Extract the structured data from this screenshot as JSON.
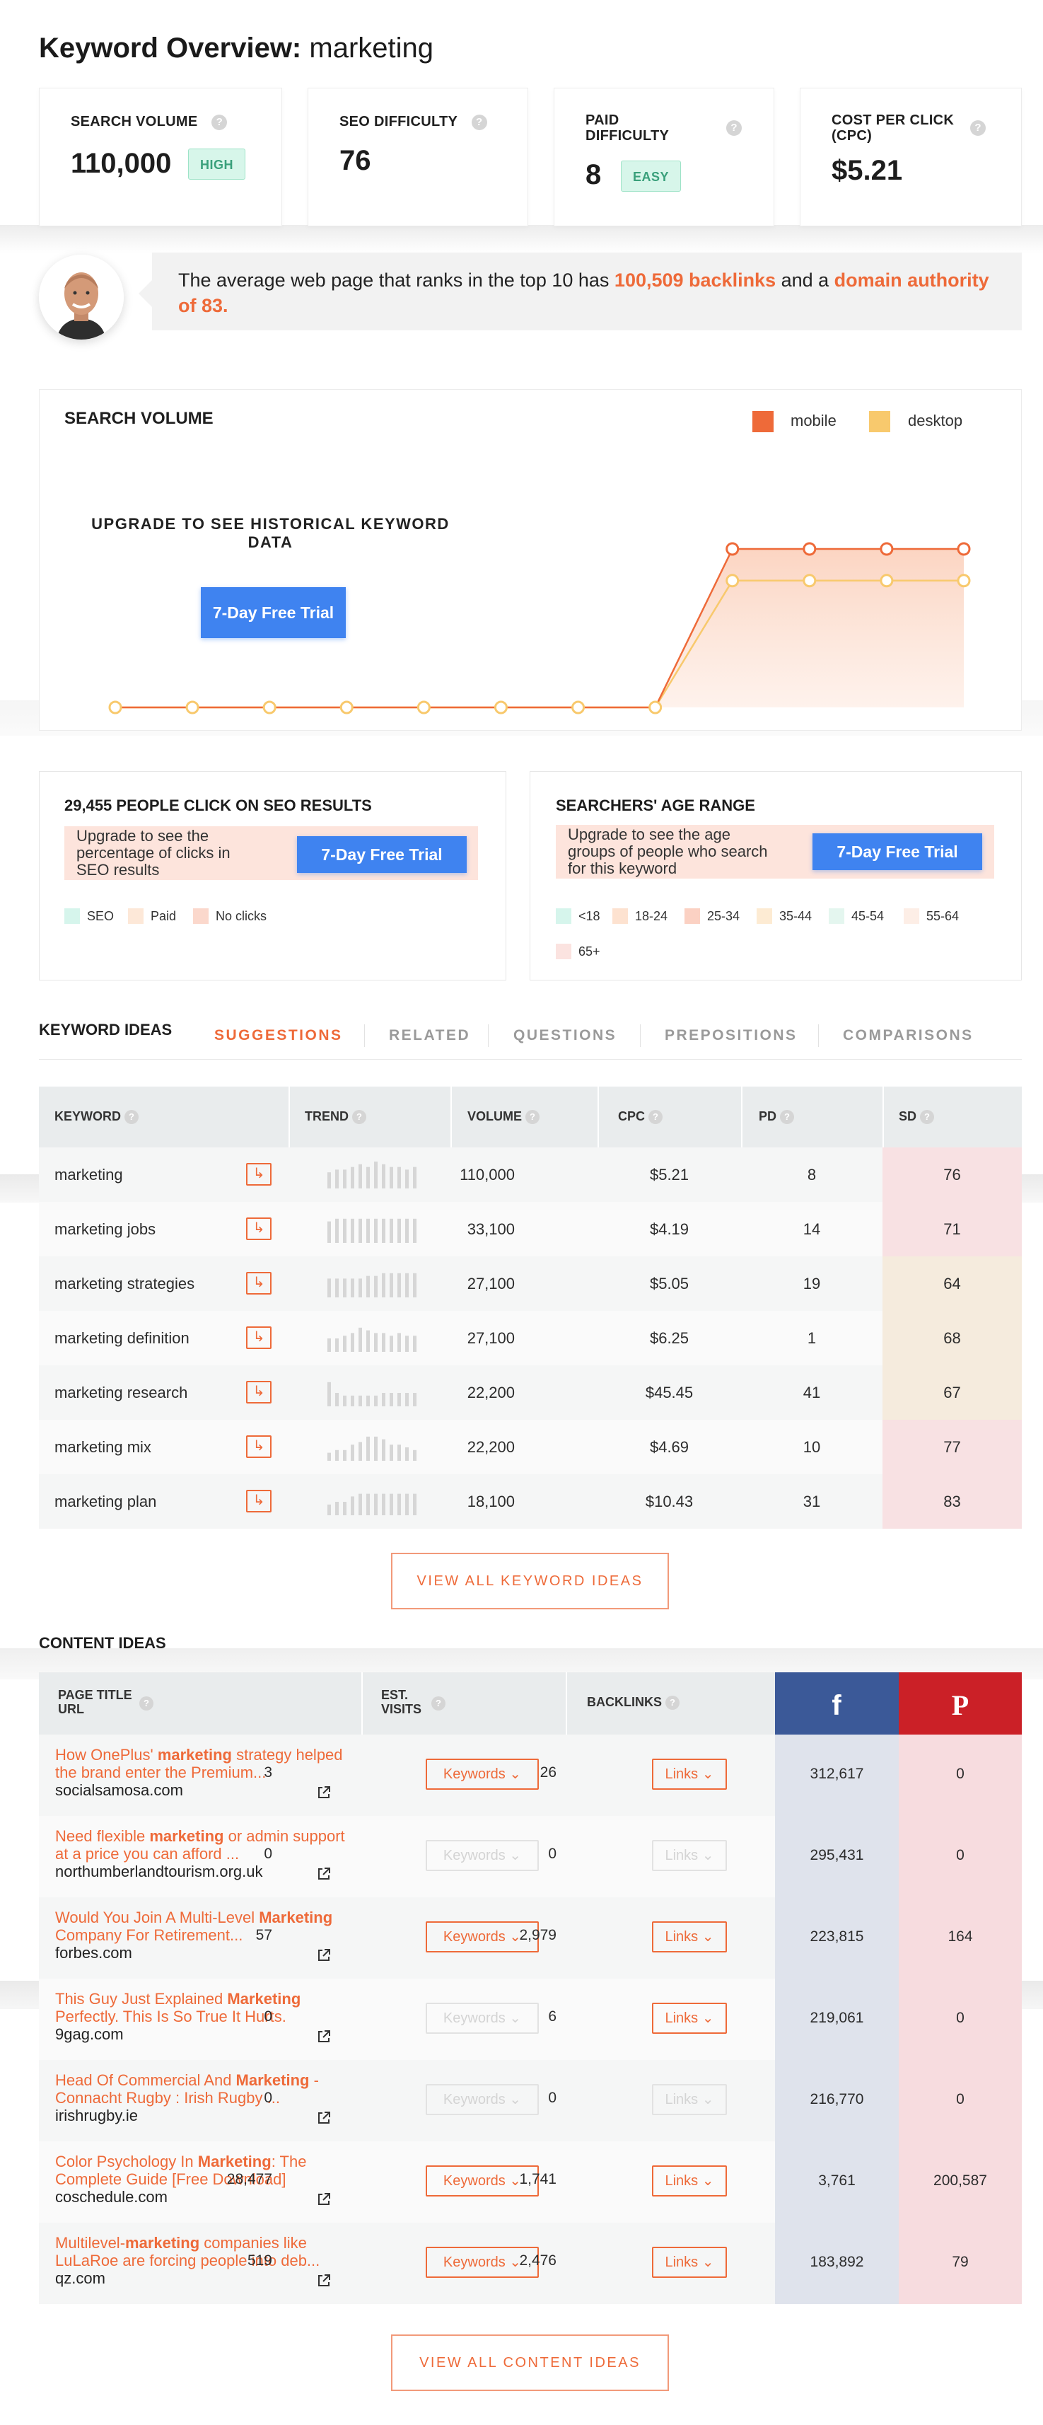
{
  "header": {
    "title_bold": "Keyword Overview:",
    "keyword": "marketing"
  },
  "metrics": [
    {
      "label": "SEARCH VOLUME",
      "value": "110,000",
      "badge": "HIGH",
      "help": "?"
    },
    {
      "label": "SEO DIFFICULTY",
      "value": "76",
      "help": "?"
    },
    {
      "label_line1": "PAID",
      "label_line2": "DIFFICULTY",
      "value": "8",
      "badge": "EASY",
      "help": "?"
    },
    {
      "label_line1": "COST PER CLICK",
      "label_line2": "(CPC)",
      "value": "$5.21",
      "help": "?"
    }
  ],
  "banner": {
    "prefix": "The average web page that ranks in the top 10 has ",
    "backlinks": "100,509 backlinks",
    "middle": " and a ",
    "authority": "domain authority of 83",
    "suffix": "."
  },
  "search_volume": {
    "title": "SEARCH VOLUME",
    "legend": [
      {
        "label": "mobile",
        "color": "#ee6a39"
      },
      {
        "label": "desktop",
        "color": "#f8c96d"
      }
    ],
    "upgrade_text": "UPGRADE TO SEE HISTORICAL KEYWORD DATA",
    "trial_label": "7-Day Free Trial",
    "chart": {
      "points": 12,
      "mobile": [
        0,
        0,
        0,
        0,
        0,
        0,
        0,
        0,
        1,
        1,
        1,
        1
      ],
      "desktop": [
        0,
        0,
        0,
        0,
        0,
        0,
        0,
        0,
        0.8,
        0.8,
        0.8,
        0.8
      ]
    }
  },
  "clicks_panel": {
    "title": "29,455 PEOPLE CLICK ON SEO RESULTS",
    "upsell": "Upgrade to see the percentage of clicks in SEO results",
    "trial_label": "7-Day Free Trial",
    "legend": [
      {
        "label": "SEO",
        "color": "#d6f5ec"
      },
      {
        "label": "Paid",
        "color": "#fde8d8"
      },
      {
        "label": "No clicks",
        "color": "#fbd8cc"
      }
    ]
  },
  "age_panel": {
    "title": "SEARCHERS' AGE RANGE",
    "upsell": "Upgrade to see the age groups of people who search for this keyword",
    "trial_label": "7-Day Free Trial",
    "legend": [
      {
        "label": "<18",
        "color": "#d6f5ec"
      },
      {
        "label": "18-24",
        "color": "#fde2d0"
      },
      {
        "label": "25-34",
        "color": "#fbd1c3"
      },
      {
        "label": "35-44",
        "color": "#fdebd3"
      },
      {
        "label": "45-54",
        "color": "#e4f6ef"
      },
      {
        "label": "55-64",
        "color": "#fdeee6"
      },
      {
        "label": "65+",
        "color": "#fbe3e0"
      }
    ]
  },
  "keyword_ideas": {
    "title": "KEYWORD IDEAS",
    "tabs": [
      "SUGGESTIONS",
      "RELATED",
      "QUESTIONS",
      "PREPOSITIONS",
      "COMPARISONS"
    ],
    "active_tab": 0,
    "columns": [
      "KEYWORD",
      "TREND",
      "VOLUME",
      "CPC",
      "PD",
      "SD"
    ],
    "rows": [
      {
        "keyword": "marketing",
        "volume": "110,000",
        "cpc": "$5.21",
        "pd": "8",
        "sd": "76",
        "sd_color": "#f8e1e3",
        "trend": [
          6,
          7,
          7,
          8,
          9,
          8,
          10,
          9,
          8,
          8,
          7,
          8
        ]
      },
      {
        "keyword": "marketing jobs",
        "volume": "33,100",
        "cpc": "$4.19",
        "pd": "14",
        "sd": "71",
        "sd_color": "#f8e1e3",
        "trend": [
          8,
          9,
          9,
          9,
          9,
          9,
          9,
          9,
          9,
          9,
          9,
          9
        ]
      },
      {
        "keyword": "marketing strategies",
        "volume": "27,100",
        "cpc": "$5.05",
        "pd": "19",
        "sd": "64",
        "sd_color": "#f5ebdd",
        "trend": [
          7,
          7,
          7,
          7,
          7,
          8,
          8,
          9,
          9,
          9,
          9,
          9
        ]
      },
      {
        "keyword": "marketing definition",
        "volume": "27,100",
        "cpc": "$6.25",
        "pd": "1",
        "sd": "68",
        "sd_color": "#f5ebdd",
        "trend": [
          5,
          5,
          6,
          7,
          9,
          8,
          7,
          7,
          6,
          7,
          6,
          6
        ]
      },
      {
        "keyword": "marketing research",
        "volume": "22,200",
        "cpc": "$45.45",
        "pd": "41",
        "sd": "67",
        "sd_color": "#f5ebdd",
        "trend": [
          9,
          5,
          4,
          4,
          4,
          4,
          4,
          5,
          5,
          5,
          5,
          5
        ]
      },
      {
        "keyword": "marketing mix",
        "volume": "22,200",
        "cpc": "$4.69",
        "pd": "10",
        "sd": "77",
        "sd_color": "#f8e1e3",
        "trend": [
          3,
          4,
          4,
          6,
          7,
          9,
          9,
          8,
          6,
          6,
          5,
          4
        ]
      },
      {
        "keyword": "marketing plan",
        "volume": "18,100",
        "cpc": "$10.43",
        "pd": "31",
        "sd": "83",
        "sd_color": "#f8e1e3",
        "trend": [
          4,
          5,
          5,
          7,
          8,
          8,
          8,
          8,
          8,
          8,
          8,
          8
        ]
      }
    ],
    "view_all": "VIEW ALL KEYWORD IDEAS"
  },
  "content_ideas": {
    "title": "CONTENT IDEAS",
    "columns": {
      "page_title": "PAGE TITLE",
      "url": "URL",
      "visits_1": "EST.",
      "visits_2": "VISITS",
      "backlinks": "BACKLINKS",
      "facebook": "f",
      "pinterest": "P"
    },
    "keywords_label": "Keywords",
    "links_label": "Links",
    "rows": [
      {
        "title_pre": "How OnePlus' ",
        "title_bold": "marketing",
        "title_post": " strategy helped the brand enter the Premium...",
        "domain": "socialsamosa.com",
        "visits": "3",
        "visits_active": true,
        "backlinks": "26",
        "links_active": true,
        "facebook": "312,617",
        "pinterest": "0"
      },
      {
        "title_pre": "Need flexible ",
        "title_bold": "marketing",
        "title_post": " or admin support at a price you can afford ...",
        "domain": "northumberlandtourism.org.uk",
        "visits": "0",
        "visits_active": false,
        "backlinks": "0",
        "links_active": false,
        "facebook": "295,431",
        "pinterest": "0"
      },
      {
        "title_pre": "Would You Join A Multi-Level ",
        "title_bold": "Marketing",
        "title_post": " Company For Retirement...",
        "domain": "forbes.com",
        "visits": "57",
        "visits_active": true,
        "backlinks": "2,979",
        "links_active": true,
        "facebook": "223,815",
        "pinterest": "164"
      },
      {
        "title_pre": "This Guy Just Explained ",
        "title_bold": "Marketing",
        "title_post": " Perfectly. This Is So True It Hurts.",
        "domain": "9gag.com",
        "visits": "0",
        "visits_active": false,
        "backlinks": "6",
        "links_active": true,
        "facebook": "219,061",
        "pinterest": "0"
      },
      {
        "title_pre": "Head Of Commercial And ",
        "title_bold": "Marketing",
        "title_post": " - Connacht Rugby : Irish Rugby ...",
        "domain": "irishrugby.ie",
        "visits": "0",
        "visits_active": false,
        "backlinks": "0",
        "links_active": false,
        "facebook": "216,770",
        "pinterest": "0"
      },
      {
        "title_pre": "Color Psychology In ",
        "title_bold": "Marketing",
        "title_post": ": The Complete Guide [Free Download]",
        "domain": "coschedule.com",
        "visits": "28,477",
        "visits_active": true,
        "backlinks": "1,741",
        "links_active": true,
        "facebook": "3,761",
        "pinterest": "200,587"
      },
      {
        "title_pre": "Multilevel-",
        "title_bold": "marketing",
        "title_post": " companies like LuLaRoe are forcing people into deb...",
        "domain": "qz.com",
        "visits": "519",
        "visits_active": true,
        "backlinks": "2,476",
        "links_active": true,
        "facebook": "183,892",
        "pinterest": "79"
      }
    ],
    "view_all": "VIEW ALL CONTENT IDEAS"
  },
  "colors": {
    "accent": "#ee6a39",
    "trial_blue": "#3f83f0",
    "facebook": "#3b5998",
    "pinterest": "#cb2027",
    "badge_green": "#3aa07b"
  }
}
